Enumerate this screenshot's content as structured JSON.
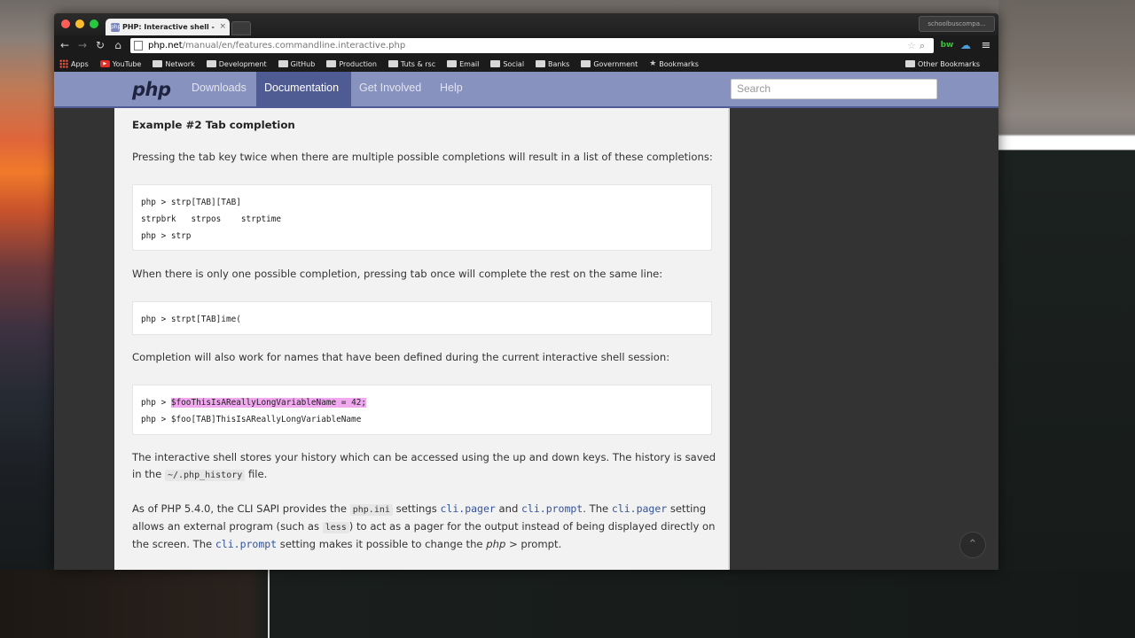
{
  "browser": {
    "tab_title": "PHP: Interactive shell - Ma",
    "tab_close": "×",
    "tab_favicon": "php",
    "profile_label": "schoolbuscompa...",
    "url_domain": "php.net",
    "url_path": "/manual/en/features.commandline.interactive.php",
    "bookmarks": [
      "Apps",
      "YouTube",
      "Network",
      "Development",
      "GitHub",
      "Production",
      "Tuts & rsc",
      "Email",
      "Social",
      "Banks",
      "Government",
      "Bookmarks"
    ],
    "other_bookmarks": "Other Bookmarks",
    "back_icon": "←",
    "forward_icon": "→",
    "reload_icon": "↻",
    "home_icon": "⌂",
    "star_icon": "☆",
    "search_icon": "⌕",
    "ext_label": "bw",
    "cloud_icon": "☁",
    "menu_icon": "≡"
  },
  "site": {
    "logo": "php",
    "nav": [
      "Downloads",
      "Documentation",
      "Get Involved",
      "Help"
    ],
    "active_nav": "Documentation",
    "search_placeholder": "Search",
    "back_to_top_icon": "⌃"
  },
  "doc": {
    "example_title": "Example #2 Tab completion",
    "p1": "Pressing the tab key twice when there are multiple possible completions will result in a list of these completions:",
    "code1": [
      "php > strp[TAB][TAB]",
      "strpbrk   strpos    strptime",
      "php > strp"
    ],
    "p2": "When there is only one possible completion, pressing tab once will complete the rest on the same line:",
    "code2": [
      "php > strpt[TAB]ime("
    ],
    "p3": "Completion will also work for names that have been defined during the current interactive shell session:",
    "code3_prefix": "php > ",
    "code3_highlight": "$fooThisIsAReallyLongVariableName = 42;",
    "code3_line2": "php > $foo[TAB]ThisIsAReallyLongVariableName",
    "p4_a": "The interactive shell stores your history which can be accessed using the up and down keys. The history is saved in the ",
    "p4_code": "~/.php_history",
    "p4_b": " file.",
    "p5_a": "As of PHP 5.4.0, the CLI SAPI provides the ",
    "p5_code1": "php.ini",
    "p5_b": " settings ",
    "p5_link1": "cli.pager",
    "p5_c": " and ",
    "p5_link2": "cli.prompt",
    "p5_d": ". The ",
    "p5_link3": "cli.pager",
    "p5_e": " setting allows an external program (such as ",
    "p5_code2": "less",
    "p5_f": ") to act as a pager for the output instead of being displayed directly on the screen. The ",
    "p5_link4": "cli.prompt",
    "p5_g": " setting makes it possible to change the ",
    "p5_em": "php",
    "p5_h": " > prompt."
  }
}
